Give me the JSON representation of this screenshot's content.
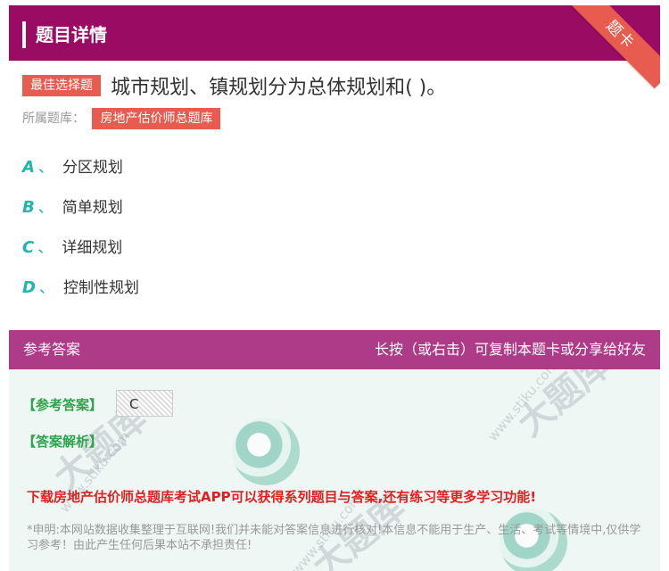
{
  "header": {
    "title": "题目详情",
    "corner_badge": "题卡"
  },
  "question": {
    "type_label": "最佳选择题",
    "text": "城市规划、镇规划分为总体规划和( )。",
    "bank_label": "所属题库：",
    "bank_name": "房地产估价师总题库"
  },
  "options": [
    {
      "letter": "A",
      "sep": "、",
      "text": "分区规划"
    },
    {
      "letter": "B",
      "sep": "、",
      "text": "简单规划"
    },
    {
      "letter": "C",
      "sep": "、",
      "text": "详细规划"
    },
    {
      "letter": "D",
      "sep": "、",
      "text": "控制性规划"
    }
  ],
  "answer": {
    "header_left": "参考答案",
    "header_right": "长按（或右击）可复制本题卡或分享给好友",
    "ref_label": "【参考答案】",
    "ref_value": "C",
    "analysis_label": "【答案解析】",
    "promo": "下载房地产估价师总题库考试APP可以获得系列题目与答案,还有练习等更多学习功能!",
    "disclaimer": "*申明:本网站数据收集整理于互联网!我们并未能对答案信息进行核对!本信息不能用于生产、生活、考试等情境中,仅供学习参考！由此产生任何后果本站不承担责任!"
  },
  "watermark": {
    "text1": "大题库",
    "text2": "www.stiku.com"
  },
  "colors": {
    "header": "#9a0c63",
    "accent_red": "#e75c4e",
    "option_letter": "#1fb5ac",
    "answer_head": "#ad3b88",
    "answer_bg": "#eef7f4"
  }
}
